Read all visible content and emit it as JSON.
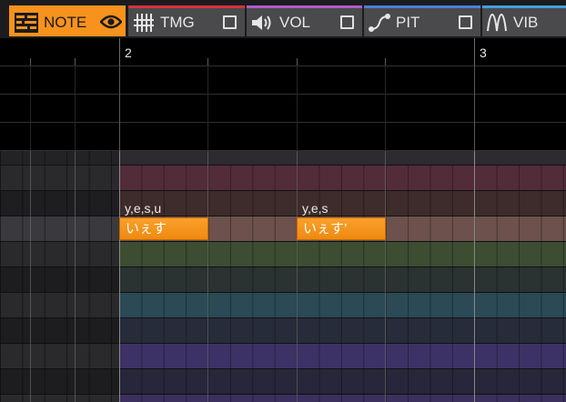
{
  "tabs": [
    {
      "id": "note",
      "label": "NOTE",
      "icon": "piano-roll-icon",
      "active": true,
      "visible_icon": "eye-icon"
    },
    {
      "id": "tmg",
      "label": "TMG",
      "icon": "timing-icon",
      "checked": false
    },
    {
      "id": "vol",
      "label": "VOL",
      "icon": "speaker-icon",
      "checked": false
    },
    {
      "id": "pit",
      "label": "PIT",
      "icon": "pitch-curve-icon",
      "checked": false
    },
    {
      "id": "vib",
      "label": "VIB",
      "icon": "vibrato-icon",
      "checked": false
    }
  ],
  "ruler": {
    "measures": [
      "2",
      "3"
    ]
  },
  "notes": [
    {
      "lyric": "いぇす",
      "phoneme": "y,e,s,u"
    },
    {
      "lyric": "いぇす’",
      "phoneme": "y,e,s"
    }
  ],
  "colors": {
    "note_tab": "#f7921d",
    "tmg": "#d8313a",
    "vol": "#b05cc9",
    "pit": "#4f7fd8",
    "vib": "#3fa0e0",
    "note_fill": "#f5931a"
  }
}
